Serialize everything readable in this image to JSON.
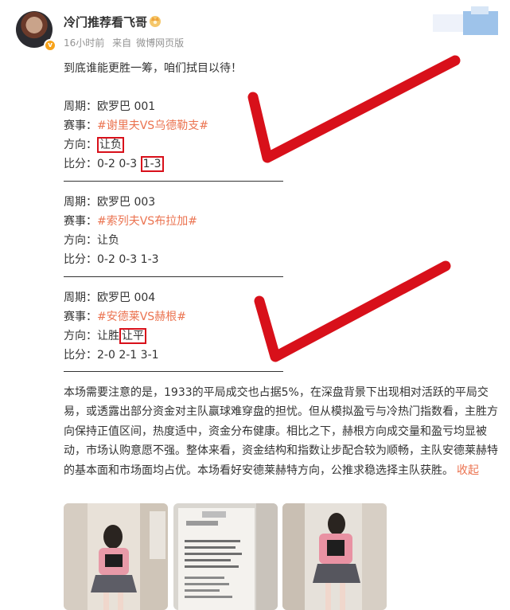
{
  "header": {
    "username": "冷门推荐看飞哥",
    "time": "16小时前",
    "source_prefix": "来自",
    "source": "微博网页版"
  },
  "post": {
    "intro": "到底谁能更胜一筹，咱们拭目以待！",
    "matches": [
      {
        "period_label": "周期：",
        "period": "欧罗巴 001",
        "event_label": "赛事：",
        "event": "#谢里夫VS乌德勒支#",
        "direction_label": "方向：",
        "direction": "让负",
        "direction_extra": "",
        "score_label": "比分：",
        "scores": [
          "0-2",
          "0-3",
          "1-3"
        ]
      },
      {
        "period_label": "周期：",
        "period": "欧罗巴 003",
        "event_label": "赛事：",
        "event": "#索列夫VS布拉加#",
        "direction_label": "方向：",
        "direction": "让负",
        "direction_extra": "",
        "score_label": "比分：",
        "scores": [
          "0-2",
          "0-3",
          "1-3"
        ]
      },
      {
        "period_label": "周期：",
        "period": "欧罗巴 004",
        "event_label": "赛事：",
        "event": "#安德莱VS赫根#",
        "direction_label": "方向：",
        "direction": "让胜",
        "direction_extra": "让平",
        "score_label": "比分：",
        "scores": [
          "2-0",
          "2-1",
          "3-1"
        ]
      }
    ],
    "analysis": "本场需要注意的是，1933的平局成交也占据5%，在深盘背景下出现相对活跃的平局交易，或透露出部分资金对主队赢球难穿盘的担忧。但从模拟盈亏与冷热门指数看，主胜方向保持正值区间，热度适中，资金分布健康。相比之下，赫根方向成交量和盈亏均显被动，市场认购意愿不强。整体来看，资金结构和指数让步配合较为顺畅，主队安德莱赫特的基本面和市场面均占优。本场看好安德莱赫特方向，公推求稳选择主队获胜。",
    "collapse_label": "收起"
  },
  "images": [
    "photo-1",
    "photo-2",
    "photo-3",
    "photo-4"
  ],
  "watermark": "",
  "colors": {
    "accent": "#eb7350",
    "mark_red": "#d8101a",
    "meta_gray": "#939393"
  }
}
